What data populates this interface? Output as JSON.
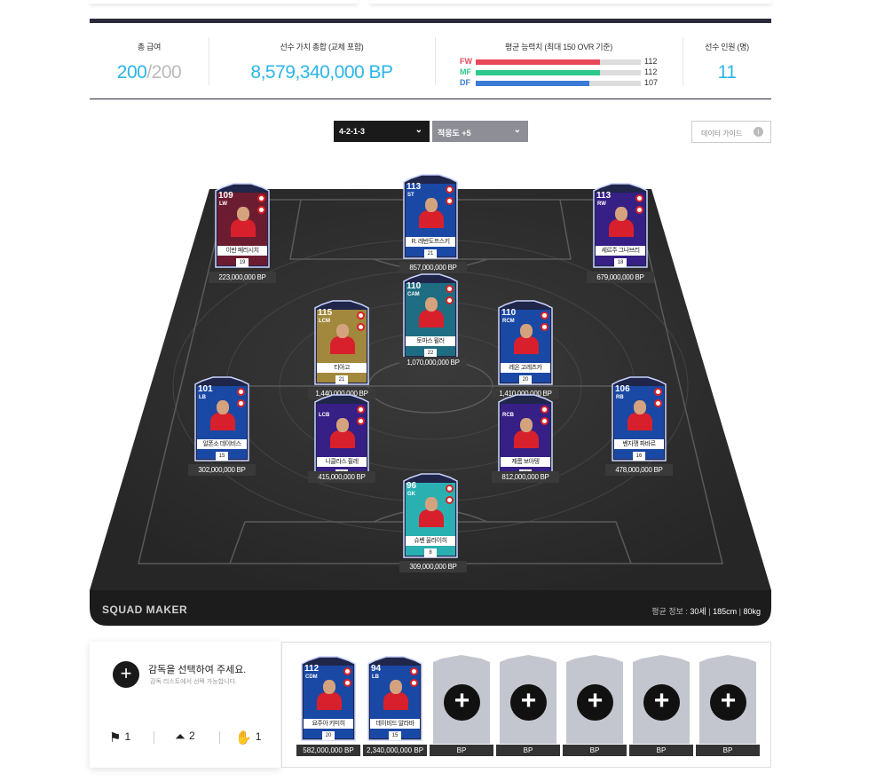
{
  "summary": {
    "total_pay_label": "총 급여",
    "total_pay_value": "200",
    "total_pay_max": "/200",
    "team_value_label": "선수 가치 총합 (교체 포함)",
    "team_value": "8,579,340,000 BP",
    "avg_ability_label": "평균 능력치 (최대 150 OVR 기준)",
    "abilities": [
      {
        "key": "FW",
        "value": "112",
        "level": 0.75,
        "color": "#e8475a"
      },
      {
        "key": "MF",
        "value": "112",
        "level": 0.75,
        "color": "#2ec98a"
      },
      {
        "key": "DF",
        "value": "107",
        "level": 0.69,
        "color": "#3a7bd5"
      }
    ],
    "player_count_label": "선수 인원 (명)",
    "player_count": "11"
  },
  "controls": {
    "formation": "4-2-1-3",
    "adaptability": "적응도 +5",
    "data_guide": "데이터 가이드",
    "info_icon": "i"
  },
  "pitch": {
    "brand": "SQUAD MAKER",
    "avg_label": "평균 정보 : ",
    "avg_age": "30세",
    "avg_height": "185cm",
    "avg_weight": "80kg",
    "sep": "|"
  },
  "players": [
    {
      "id": "lw",
      "ovr": "109",
      "pos": "LW",
      "name": "이반 페리시치",
      "level": "19",
      "price": "223,000,000 BP",
      "accent": "#7a1b2c"
    },
    {
      "id": "st",
      "ovr": "113",
      "pos": "ST",
      "name": "R. 레반도프스키",
      "level": "21",
      "price": "857,000,000 BP",
      "accent": "#1a4fb5"
    },
    {
      "id": "rw",
      "ovr": "113",
      "pos": "RW",
      "name": "세르주 그나브리",
      "level": "18",
      "price": "679,000,000 BP",
      "accent": "#3b1f8f"
    },
    {
      "id": "lcm",
      "ovr": "115",
      "pos": "LCM",
      "name": "티아고",
      "level": "21",
      "price": "1,440,000,000 BP",
      "accent": "#b89a3a"
    },
    {
      "id": "cam",
      "ovr": "110",
      "pos": "CAM",
      "name": "토마스 뮐러",
      "level": "22",
      "price": "1,070,000,000 BP",
      "accent": "#1e7a8c"
    },
    {
      "id": "rcm",
      "ovr": "110",
      "pos": "RCM",
      "name": "레온 고레츠카",
      "level": "20",
      "price": "1,410,000,000 BP",
      "accent": "#1a4fb5"
    },
    {
      "id": "lb",
      "ovr": "101",
      "pos": "LB",
      "name": "알폰소 데이비스",
      "level": "15",
      "price": "302,000,000 BP",
      "accent": "#1a4fb5"
    },
    {
      "id": "lcb",
      "ovr": "",
      "pos": "LCB",
      "name": "니클라스 쥘레",
      "level": "20",
      "price": "415,000,000 BP",
      "accent": "#3b1f8f"
    },
    {
      "id": "rcb",
      "ovr": "",
      "pos": "RCB",
      "name": "제롬 보아텡",
      "level": "20",
      "price": "812,000,000 BP",
      "accent": "#3b1f8f"
    },
    {
      "id": "rb",
      "ovr": "106",
      "pos": "RB",
      "name": "벤자맹 파바르",
      "level": "16",
      "price": "478,000,000 BP",
      "accent": "#1a4fb5"
    },
    {
      "id": "gk",
      "ovr": "96",
      "pos": "GK",
      "name": "슈벤 울라이히",
      "level": "8",
      "price": "309,000,000 BP",
      "accent": "#2ec9c4"
    }
  ],
  "coach": {
    "plus": "+",
    "title": "감독을 선택하여 주세요.",
    "subtitle": "감독 리스트에서 선택 가능합니다.",
    "strategies": [
      {
        "icon": "flag-icon",
        "value": "1"
      },
      {
        "icon": "arrow-up-icon",
        "value": "2"
      },
      {
        "icon": "handshake-icon",
        "value": "1"
      }
    ]
  },
  "subs": [
    {
      "ovr": "112",
      "pos": "CDM",
      "name": "요주아 키미히",
      "level": "20",
      "price": "582,000,000 BP",
      "filled": true
    },
    {
      "ovr": "94",
      "pos": "LB",
      "name": "데이비드 알라바",
      "level": "15",
      "price": "2,340,000,000 BP",
      "filled": true
    },
    {
      "plus": "+",
      "price": "BP",
      "filled": false
    },
    {
      "plus": "+",
      "price": "BP",
      "filled": false
    },
    {
      "plus": "+",
      "price": "BP",
      "filled": false
    },
    {
      "plus": "+",
      "price": "BP",
      "filled": false
    },
    {
      "plus": "+",
      "price": "BP",
      "filled": false
    }
  ]
}
